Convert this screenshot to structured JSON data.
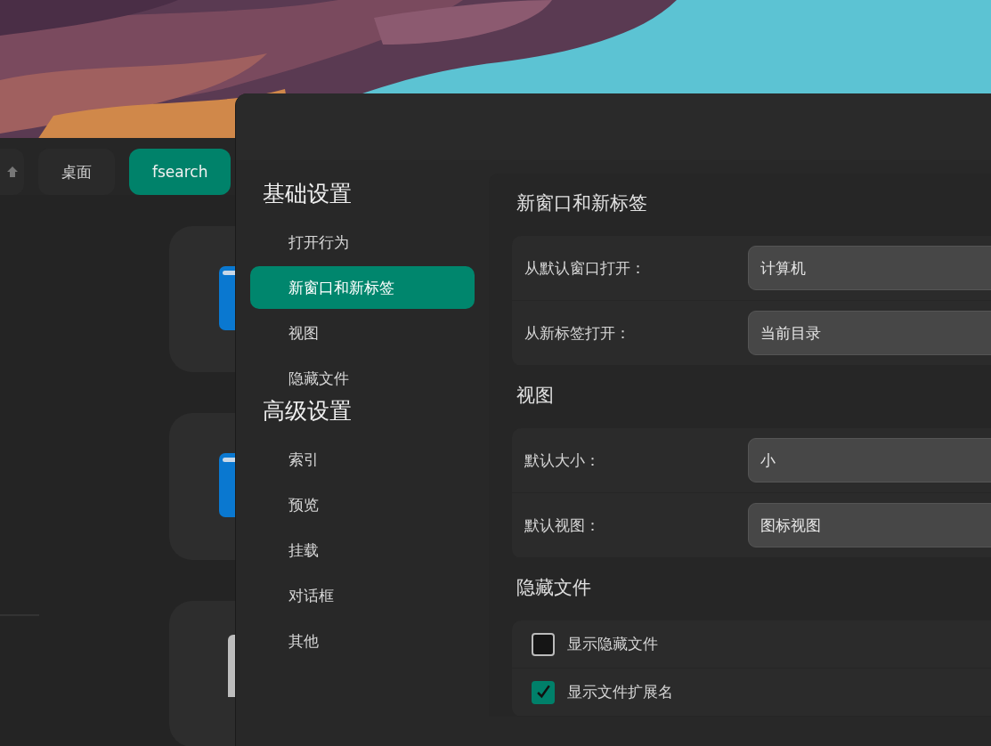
{
  "file_manager": {
    "breadcrumbs": [
      {
        "kind": "home",
        "selected": false
      },
      {
        "kind": "text",
        "label": "桌面",
        "selected": false
      },
      {
        "kind": "text",
        "label": "fsearch",
        "selected": true
      }
    ],
    "items": [
      {
        "kind": "folder"
      },
      {
        "kind": "folder"
      },
      {
        "kind": "file"
      }
    ]
  },
  "settings": {
    "nav_groups": [
      {
        "title": "基础设置",
        "items": [
          {
            "label": "打开行为",
            "selected": false
          },
          {
            "label": "新窗口和新标签",
            "selected": true
          },
          {
            "label": "视图",
            "selected": false
          },
          {
            "label": "隐藏文件",
            "selected": false
          }
        ]
      },
      {
        "title": "高级设置",
        "items": [
          {
            "label": "索引",
            "selected": false
          },
          {
            "label": "预览",
            "selected": false
          },
          {
            "label": "挂载",
            "selected": false
          },
          {
            "label": "对话框",
            "selected": false
          },
          {
            "label": "其他",
            "selected": false
          }
        ]
      }
    ],
    "sections": [
      {
        "title": "新窗口和新标签",
        "rows": [
          {
            "kind": "select",
            "label": "从默认窗口打开：",
            "value": "计算机"
          },
          {
            "kind": "select",
            "label": "从新标签打开：",
            "value": "当前目录"
          }
        ]
      },
      {
        "title": "视图",
        "rows": [
          {
            "kind": "select",
            "label": "默认大小：",
            "value": "小"
          },
          {
            "kind": "select",
            "label": "默认视图：",
            "value": "图标视图"
          }
        ]
      },
      {
        "title": "隐藏文件",
        "rows": [
          {
            "kind": "checkbox",
            "label": "显示隐藏文件",
            "checked": false
          },
          {
            "kind": "checkbox",
            "label": "显示文件扩展名",
            "checked": true
          }
        ]
      }
    ]
  }
}
